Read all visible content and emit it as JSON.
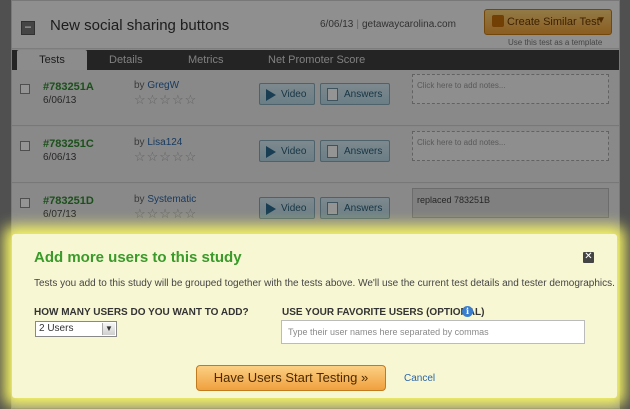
{
  "study": {
    "title": "New social sharing buttons",
    "date": "6/06/13",
    "site": "getawaycarolina.com",
    "create_similar_label": "Create Similar Test",
    "template_hint": "Use this test as a template"
  },
  "tabs": [
    {
      "label": "Tests",
      "active": true
    },
    {
      "label": "Details",
      "active": false
    },
    {
      "label": "Metrics",
      "active": false
    },
    {
      "label": "Net Promoter Score",
      "active": false
    }
  ],
  "tests": [
    {
      "id": "#783251A",
      "date": "6/06/13",
      "by": "by",
      "tester": "GregW",
      "rating": 0,
      "video_label": "Video",
      "answers_label": "Answers",
      "notes": "Click here to add notes..."
    },
    {
      "id": "#783251C",
      "date": "6/06/13",
      "by": "by",
      "tester": "Lisa124",
      "rating": 0,
      "video_label": "Video",
      "answers_label": "Answers",
      "notes": "Click here to add notes..."
    },
    {
      "id": "#783251D",
      "date": "6/07/13",
      "by": "by",
      "tester": "Systematic",
      "rating": 0,
      "video_label": "Video",
      "answers_label": "Answers",
      "notes": "replaced 783251B"
    }
  ],
  "modal": {
    "title": "Add more users to this study",
    "close_icon": "close-icon",
    "description": "Tests you add to this study will be grouped together with the tests above. We'll use the current test details and tester demographics.",
    "count_label": "HOW MANY USERS DO YOU WANT TO ADD?",
    "count_value": "2 Users",
    "fav_label": "USE YOUR FAVORITE USERS (OPTIONAL)",
    "fav_placeholder": "Type their user names here separated by commas",
    "start_label": "Have Users Start Testing »",
    "cancel_label": "Cancel"
  },
  "colors": {
    "accent_orange": "#f0a13a",
    "modal_bg": "#f8f7d4",
    "modal_glow": "#f6f463",
    "title_green": "#3a9a2a",
    "link_blue": "#2a66a8"
  }
}
